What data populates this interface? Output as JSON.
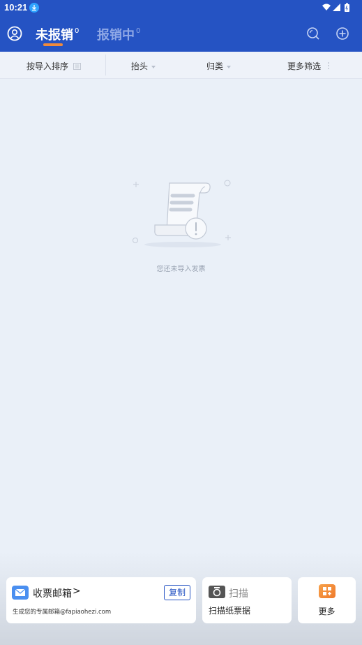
{
  "status_bar": {
    "time": "10:21"
  },
  "header": {
    "tabs": [
      {
        "label": "未报销",
        "count": "0",
        "active": true
      },
      {
        "label": "报销中",
        "count": "0",
        "active": false
      }
    ]
  },
  "filters": {
    "sort": "按导入排序",
    "title": "抬头",
    "category": "归类",
    "more": "更多筛选"
  },
  "empty_state": {
    "message": "您还未导入发票"
  },
  "bottom_cards": {
    "mailbox": {
      "title": "收票邮箱",
      "chevron": ">",
      "copy_label": "复制",
      "subtitle": "生成您的专属邮箱@fapiaohezi.com"
    },
    "scan": {
      "title": "扫描",
      "subtitle": "扫描纸票据"
    },
    "more": {
      "label": "更多"
    }
  },
  "colors": {
    "primary": "#2553c3",
    "accent": "#f08a3c",
    "background": "#eaf0f8"
  },
  "icons": [
    "profile-icon",
    "search-icon",
    "add-icon",
    "filter-icon",
    "mail-icon",
    "camera-icon",
    "apps-icon",
    "wifi-icon",
    "signal-icon",
    "battery-icon",
    "download-icon"
  ]
}
